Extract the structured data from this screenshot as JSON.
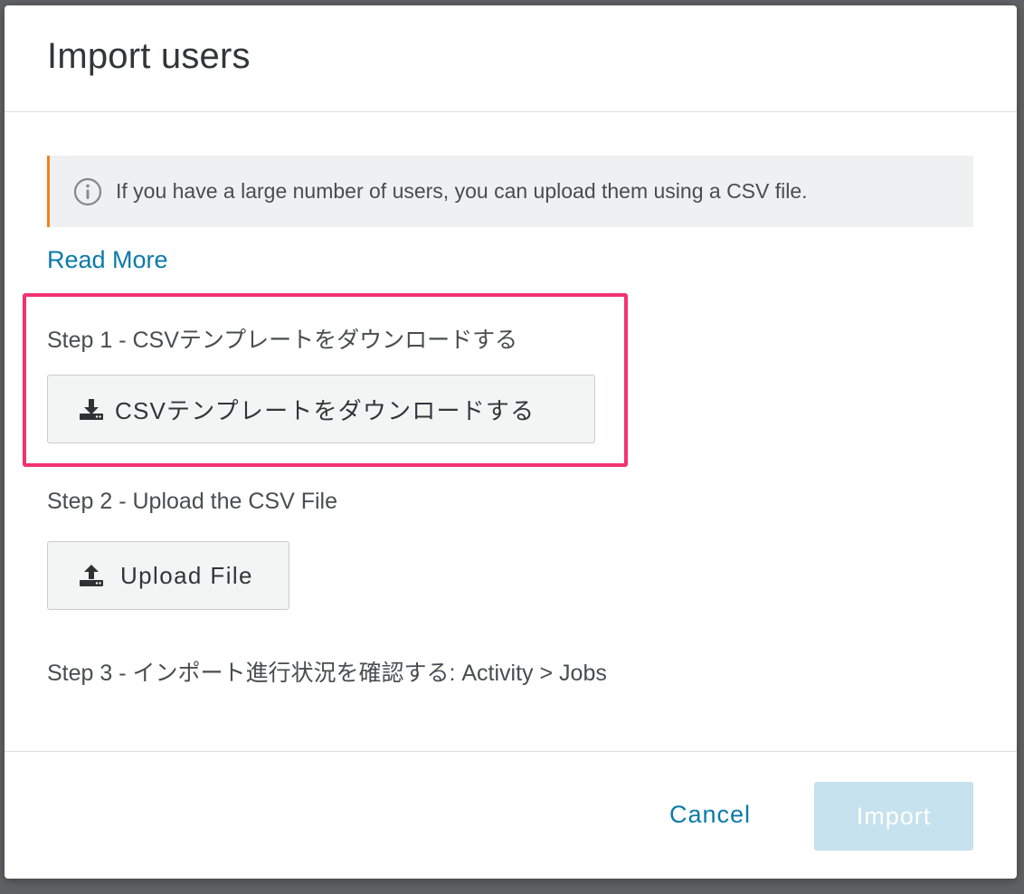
{
  "dialog": {
    "title": "Import users"
  },
  "info_banner": {
    "icon": "info-icon",
    "accent_color": "#f0821e",
    "text": "If you have a large number of users, you can upload them using a CSV file."
  },
  "read_more": {
    "label": "Read More",
    "color": "#0b7aa8"
  },
  "steps": {
    "step1": {
      "label": "Step 1 - CSVテンプレートをダウンロードする",
      "button_label": "CSVテンプレートをダウンロードする",
      "button_icon": "download-icon",
      "highlight_color": "#f2336f"
    },
    "step2": {
      "label": "Step 2 - Upload the CSV File",
      "button_label": "Upload File",
      "button_icon": "upload-icon"
    },
    "step3": {
      "label": "Step 3 - インポート進行状況を確認する: Activity > Jobs"
    }
  },
  "footer": {
    "cancel_label": "Cancel",
    "import_label": "Import",
    "import_disabled": true,
    "import_color": "#c5e2ee"
  }
}
